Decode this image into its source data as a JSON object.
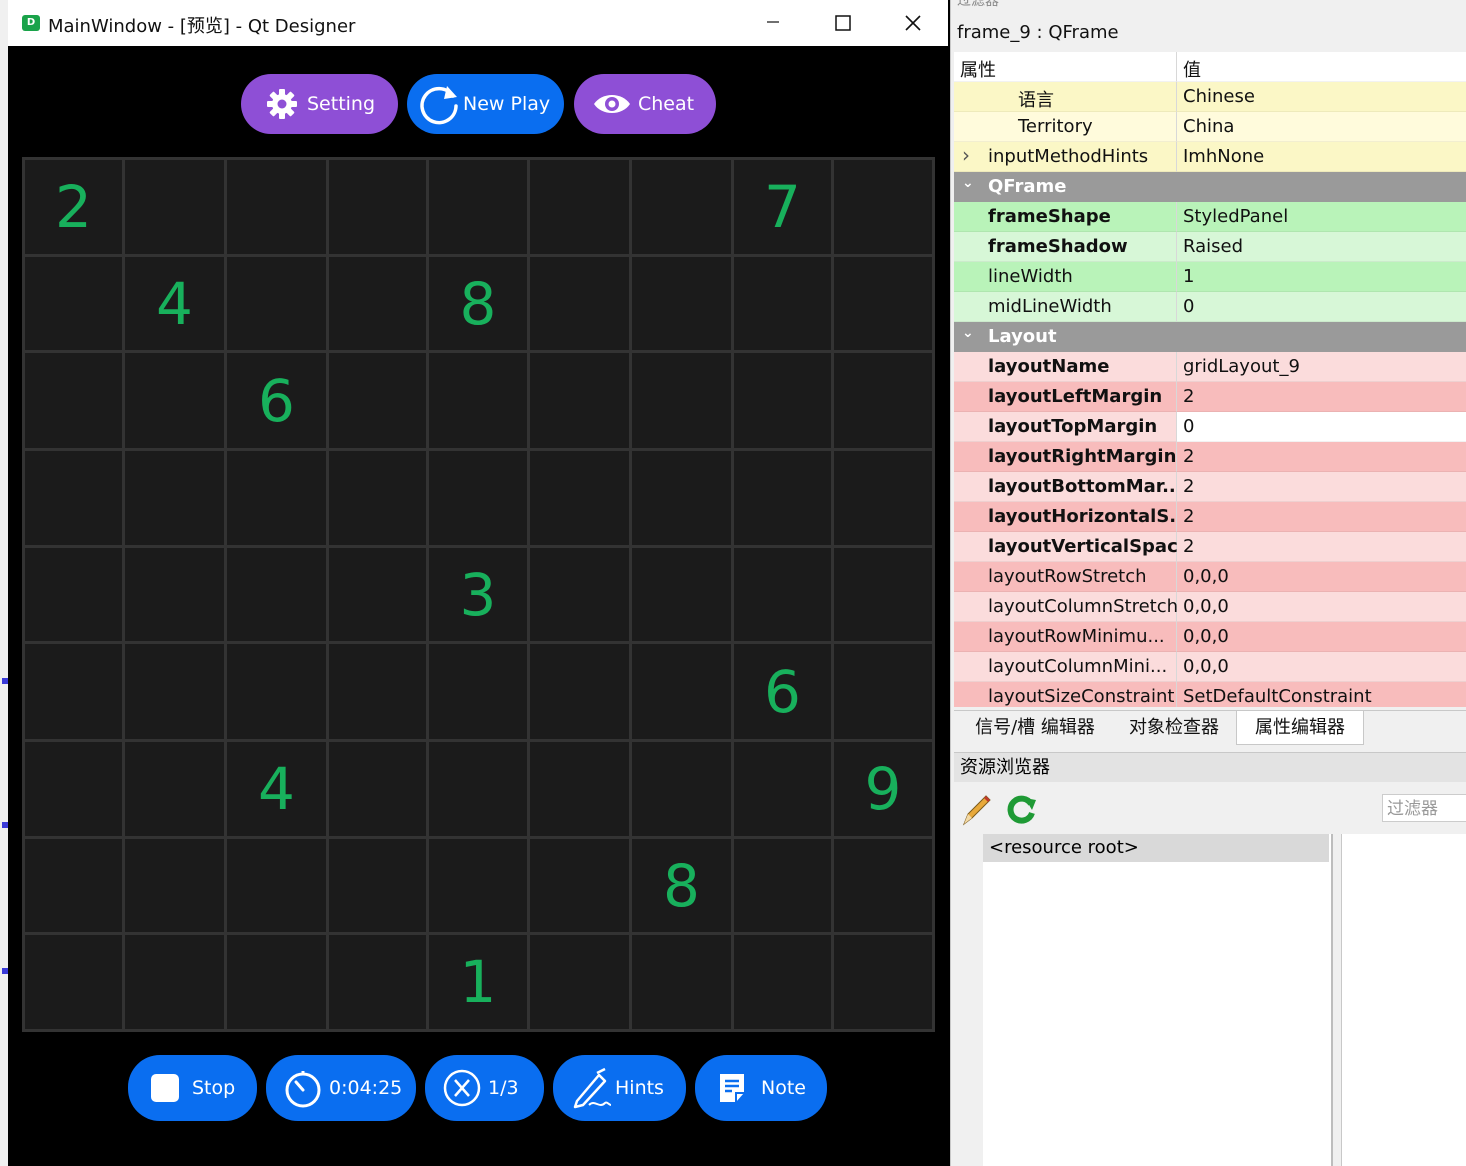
{
  "window": {
    "title": "MainWindow - [预览] - Qt Designer",
    "app_icon": "D",
    "minimize_icon": "minimize-icon",
    "maximize_icon": "maximize-icon",
    "close_icon": "close-icon"
  },
  "top_buttons": {
    "setting": "Setting",
    "new_play": "New Play",
    "cheat": "Cheat"
  },
  "board": {
    "rows": [
      [
        "2",
        "",
        "",
        "",
        "",
        "",
        "",
        "7",
        ""
      ],
      [
        "",
        "4",
        "",
        "",
        "8",
        "",
        "",
        "",
        ""
      ],
      [
        "",
        "",
        "6",
        "",
        "",
        "",
        "",
        "",
        ""
      ],
      [
        "",
        "",
        "",
        "",
        "",
        "",
        "",
        "",
        ""
      ],
      [
        "",
        "",
        "",
        "",
        "3",
        "",
        "",
        "",
        ""
      ],
      [
        "",
        "",
        "",
        "",
        "",
        "",
        "",
        "6",
        ""
      ],
      [
        "",
        "",
        "4",
        "",
        "",
        "",
        "",
        "",
        "9"
      ],
      [
        "",
        "",
        "",
        "",
        "",
        "",
        "8",
        "",
        ""
      ],
      [
        "",
        "",
        "",
        "",
        "1",
        "",
        "",
        "",
        ""
      ]
    ]
  },
  "bottom_buttons": {
    "stop": "Stop",
    "timer": "0:04:25",
    "mistakes": "1/3",
    "hints": "Hints",
    "note": "Note"
  },
  "colors": {
    "purple": "#8e4fd6",
    "blue": "#0a6ef0",
    "digit_green": "#18b05c",
    "cell_bg": "#1b1b1b"
  },
  "props": {
    "filter_top": "过滤器",
    "object_label": "frame_9 : QFrame",
    "col_property": "属性",
    "col_value": "值",
    "rows": [
      {
        "name": "语言",
        "value": "Chinese",
        "bold": false,
        "indent": 2,
        "bg": "#fbf7c6",
        "vbg": "#fbf7c6"
      },
      {
        "name": "Territory",
        "value": "China",
        "bold": false,
        "indent": 2,
        "bg": "#fffbdc",
        "vbg": "#fffbdc"
      },
      {
        "name": "inputMethodHints",
        "value": "ImhNone",
        "bold": false,
        "indent": 1,
        "bg": "#fbf7c6",
        "vbg": "#fbf7c6",
        "expander": true
      },
      {
        "name": "QFrame",
        "value": "",
        "section": true
      },
      {
        "name": "frameShape",
        "value": "StyledPanel",
        "bold": true,
        "indent": 1,
        "bg": "#b9f3b9",
        "vbg": "#b9f3b9"
      },
      {
        "name": "frameShadow",
        "value": "Raised",
        "bold": true,
        "indent": 1,
        "bg": "#d7f7d7",
        "vbg": "#d7f7d7"
      },
      {
        "name": "lineWidth",
        "value": "1",
        "bold": false,
        "indent": 1,
        "bg": "#b9f3b9",
        "vbg": "#b9f3b9"
      },
      {
        "name": "midLineWidth",
        "value": "0",
        "bold": false,
        "indent": 1,
        "bg": "#d7f7d7",
        "vbg": "#d7f7d7"
      },
      {
        "name": "Layout",
        "value": "",
        "section": true
      },
      {
        "name": "layoutName",
        "value": "gridLayout_9",
        "bold": true,
        "indent": 1,
        "bg": "#fbdcdc",
        "vbg": "#fbdcdc"
      },
      {
        "name": "layoutLeftMargin",
        "value": "2",
        "bold": true,
        "indent": 1,
        "bg": "#f8bcbc",
        "vbg": "#f8bcbc"
      },
      {
        "name": "layoutTopMargin",
        "value": "0",
        "bold": true,
        "indent": 1,
        "bg": "#fbdcdc",
        "vbg": "#ffffff"
      },
      {
        "name": "layoutRightMargin",
        "value": "2",
        "bold": true,
        "indent": 1,
        "bg": "#f8bcbc",
        "vbg": "#f8bcbc"
      },
      {
        "name": "layoutBottomMar...",
        "value": "2",
        "bold": true,
        "indent": 1,
        "bg": "#fbdcdc",
        "vbg": "#fbdcdc"
      },
      {
        "name": "layoutHorizontalS...",
        "value": "2",
        "bold": true,
        "indent": 1,
        "bg": "#f8bcbc",
        "vbg": "#f8bcbc"
      },
      {
        "name": "layoutVerticalSpac...",
        "value": "2",
        "bold": true,
        "indent": 1,
        "bg": "#fbdcdc",
        "vbg": "#fbdcdc"
      },
      {
        "name": "layoutRowStretch",
        "value": "0,0,0",
        "bold": false,
        "indent": 1,
        "bg": "#f8bcbc",
        "vbg": "#f8bcbc"
      },
      {
        "name": "layoutColumnStretch",
        "value": "0,0,0",
        "bold": false,
        "indent": 1,
        "bg": "#fbdcdc",
        "vbg": "#fbdcdc"
      },
      {
        "name": "layoutRowMinimu...",
        "value": "0,0,0",
        "bold": false,
        "indent": 1,
        "bg": "#f8bcbc",
        "vbg": "#f8bcbc"
      },
      {
        "name": "layoutColumnMini...",
        "value": "0,0,0",
        "bold": false,
        "indent": 1,
        "bg": "#fbdcdc",
        "vbg": "#fbdcdc"
      },
      {
        "name": "layoutSizeConstraint",
        "value": "SetDefaultConstraint",
        "bold": false,
        "indent": 1,
        "bg": "#f8bcbc",
        "vbg": "#f8bcbc"
      }
    ],
    "tabs": [
      "信号/槽 编辑器",
      "对象检查器",
      "属性编辑器"
    ],
    "active_tab": "属性编辑器"
  },
  "resources": {
    "title": "资源浏览器",
    "filter_placeholder": "过滤器",
    "root": "<resource root>",
    "edit_icon": "pencil-icon",
    "reload_icon": "reload-icon"
  }
}
